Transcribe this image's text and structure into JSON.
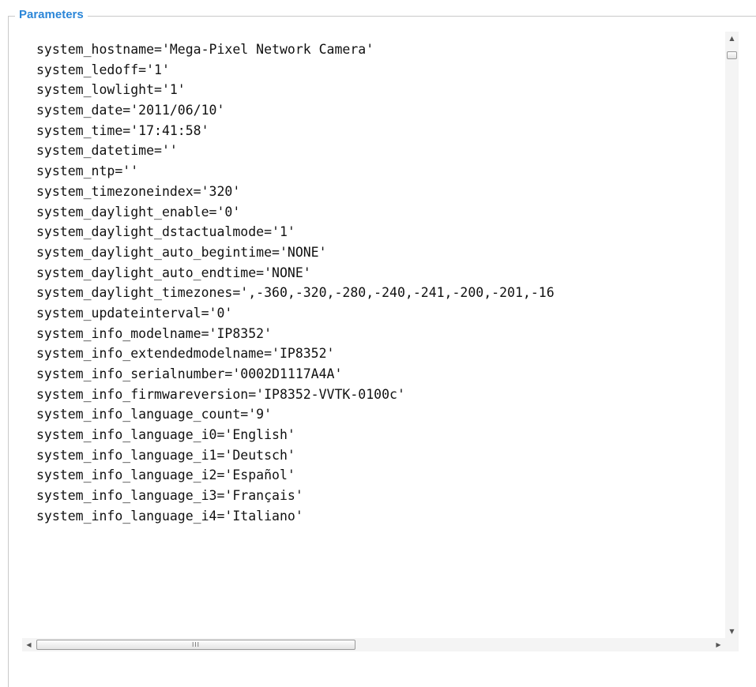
{
  "legend": "Parameters",
  "lines": [
    "system_hostname='Mega-Pixel Network Camera'",
    "system_ledoff='1'",
    "system_lowlight='1'",
    "system_date='2011/06/10'",
    "system_time='17:41:58'",
    "system_datetime=''",
    "system_ntp=''",
    "system_timezoneindex='320'",
    "system_daylight_enable='0'",
    "system_daylight_dstactualmode='1'",
    "system_daylight_auto_begintime='NONE'",
    "system_daylight_auto_endtime='NONE'",
    "system_daylight_timezones=',-360,-320,-280,-240,-241,-200,-201,-16",
    "system_updateinterval='0'",
    "system_info_modelname='IP8352'",
    "system_info_extendedmodelname='IP8352'",
    "system_info_serialnumber='0002D1117A4A'",
    "system_info_firmwareversion='IP8352-VVTK-0100c'",
    "system_info_language_count='9'",
    "system_info_language_i0='English'",
    "system_info_language_i1='Deutsch'",
    "system_info_language_i2='Español'",
    "system_info_language_i3='Français'",
    "system_info_language_i4='Italiano'"
  ],
  "scrollbar": {
    "up_icon": "▲",
    "down_icon": "▼",
    "left_icon": "◀",
    "right_icon": "▶",
    "grip": "III"
  },
  "colors": {
    "legend": "#2b86d8",
    "text": "#111111"
  }
}
